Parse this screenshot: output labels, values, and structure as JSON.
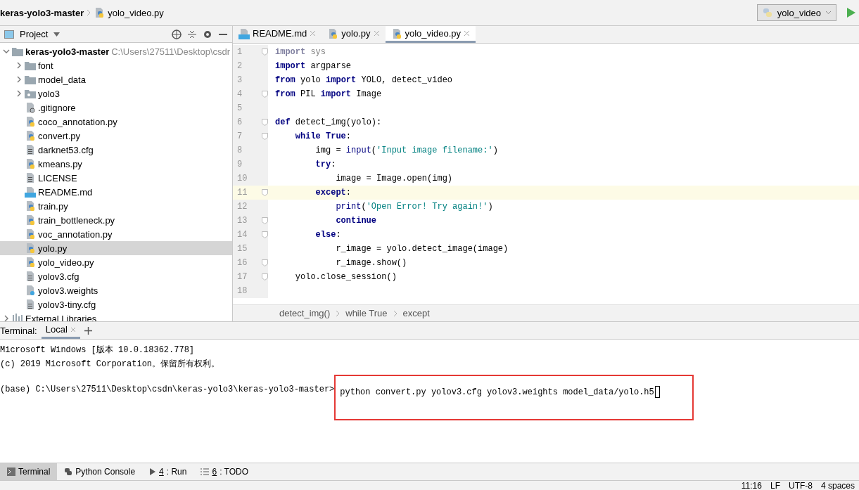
{
  "navbar": {
    "crumbs": [
      {
        "label": "keras-yolo3-master",
        "kind": "folder"
      },
      {
        "label": "yolo_video.py",
        "kind": "python"
      }
    ],
    "run_config": "yolo_video"
  },
  "project": {
    "title": "Project",
    "tree": [
      {
        "label": "keras-yolo3-master",
        "kind": "folder",
        "path": "C:\\Users\\27511\\Desktop\\csdr",
        "expanded": true,
        "selected": false,
        "children": [
          {
            "label": "font",
            "kind": "folder",
            "expanded": false,
            "selected": false
          },
          {
            "label": "model_data",
            "kind": "folder",
            "expanded": false,
            "selected": false
          },
          {
            "label": "yolo3",
            "kind": "package",
            "expanded": false,
            "selected": false
          },
          {
            "label": ".gitignore",
            "kind": "ignore",
            "selected": false
          },
          {
            "label": "coco_annotation.py",
            "kind": "python",
            "selected": false
          },
          {
            "label": "convert.py",
            "kind": "python",
            "selected": false
          },
          {
            "label": "darknet53.cfg",
            "kind": "text",
            "selected": false
          },
          {
            "label": "kmeans.py",
            "kind": "python",
            "selected": false
          },
          {
            "label": "LICENSE",
            "kind": "text",
            "selected": false
          },
          {
            "label": "README.md",
            "kind": "md",
            "selected": false
          },
          {
            "label": "train.py",
            "kind": "python",
            "selected": false
          },
          {
            "label": "train_bottleneck.py",
            "kind": "python",
            "selected": false
          },
          {
            "label": "voc_annotation.py",
            "kind": "python",
            "selected": false
          },
          {
            "label": "yolo.py",
            "kind": "python",
            "selected": true
          },
          {
            "label": "yolo_video.py",
            "kind": "python",
            "selected": false
          },
          {
            "label": "yolov3.cfg",
            "kind": "text",
            "selected": false
          },
          {
            "label": "yolov3.weights",
            "kind": "unknown",
            "selected": false
          },
          {
            "label": "yolov3-tiny.cfg",
            "kind": "text",
            "selected": false
          }
        ]
      },
      {
        "label": "External Libraries",
        "kind": "library",
        "expanded": false,
        "selected": false
      }
    ]
  },
  "editor": {
    "tabs": [
      {
        "label": "README.md",
        "kind": "md",
        "selected": false
      },
      {
        "label": "yolo.py",
        "kind": "python",
        "selected": false
      },
      {
        "label": "yolo_video.py",
        "kind": "python",
        "selected": true
      }
    ],
    "lines": [
      {
        "number": "1",
        "fold": true,
        "current": false,
        "tokens": [
          {
            "text": "import",
            "kind": "dimkw"
          },
          {
            "text": " sys",
            "kind": "dim"
          }
        ]
      },
      {
        "number": "2",
        "fold": false,
        "current": false,
        "tokens": [
          {
            "text": "import",
            "kind": "keyword"
          },
          {
            "text": " argparse",
            "kind": "plain"
          }
        ]
      },
      {
        "number": "3",
        "fold": false,
        "current": false,
        "tokens": [
          {
            "text": "from",
            "kind": "keyword"
          },
          {
            "text": " yolo ",
            "kind": "plain"
          },
          {
            "text": "import",
            "kind": "keyword"
          },
          {
            "text": " YOLO, detect_video",
            "kind": "plain"
          }
        ]
      },
      {
        "number": "4",
        "fold": true,
        "current": false,
        "tokens": [
          {
            "text": "from",
            "kind": "keyword"
          },
          {
            "text": " PIL ",
            "kind": "plain"
          },
          {
            "text": "import",
            "kind": "keyword"
          },
          {
            "text": " Image",
            "kind": "plain"
          }
        ]
      },
      {
        "number": "5",
        "fold": false,
        "current": false
      },
      {
        "number": "6",
        "fold": true,
        "current": false,
        "tokens": [
          {
            "text": "def",
            "kind": "keyword"
          },
          {
            "text": " detect_img(yolo):",
            "kind": "plain"
          }
        ]
      },
      {
        "number": "7",
        "fold": true,
        "current": false,
        "tokens": [
          {
            "text": "    while True",
            "kind": "keyword"
          },
          {
            "text": ":",
            "kind": "plain"
          }
        ]
      },
      {
        "number": "8",
        "fold": false,
        "current": false,
        "tokens": [
          {
            "text": "        img = ",
            "kind": "plain"
          },
          {
            "text": "input",
            "kind": "builtin"
          },
          {
            "text": "(",
            "kind": "plain"
          },
          {
            "text": "'Input image filename:'",
            "kind": "string"
          },
          {
            "text": ")",
            "kind": "plain"
          }
        ]
      },
      {
        "number": "9",
        "fold": false,
        "current": false,
        "tokens": [
          {
            "text": "        try",
            "kind": "keyword"
          },
          {
            "text": ":",
            "kind": "plain"
          }
        ]
      },
      {
        "number": "10",
        "fold": false,
        "current": false,
        "tokens": [
          {
            "text": "            image = Image.open(img)",
            "kind": "plain"
          }
        ]
      },
      {
        "number": "11",
        "fold": true,
        "current": true,
        "tokens": [
          {
            "text": "        except",
            "kind": "keyword"
          },
          {
            "text": ":",
            "kind": "plain"
          }
        ]
      },
      {
        "number": "12",
        "fold": false,
        "current": false,
        "tokens": [
          {
            "text": "            print",
            "kind": "builtin"
          },
          {
            "text": "(",
            "kind": "plain"
          },
          {
            "text": "'Open Error! Try again!'",
            "kind": "string"
          },
          {
            "text": ")",
            "kind": "plain"
          }
        ]
      },
      {
        "number": "13",
        "fold": true,
        "current": false,
        "tokens": [
          {
            "text": "            continue",
            "kind": "keyword"
          }
        ]
      },
      {
        "number": "14",
        "fold": true,
        "current": false,
        "tokens": [
          {
            "text": "        else",
            "kind": "keyword"
          },
          {
            "text": ":",
            "kind": "plain"
          }
        ]
      },
      {
        "number": "15",
        "fold": false,
        "current": false,
        "tokens": [
          {
            "text": "            r_image = yolo.detect_image(image)",
            "kind": "plain"
          }
        ]
      },
      {
        "number": "16",
        "fold": true,
        "current": false,
        "tokens": [
          {
            "text": "            r_image.show()",
            "kind": "plain"
          }
        ]
      },
      {
        "number": "17",
        "fold": true,
        "current": false,
        "tokens": [
          {
            "text": "    yolo.close_session()",
            "kind": "plain"
          }
        ]
      },
      {
        "number": "18",
        "fold": false,
        "current": false
      }
    ],
    "breadcrumbs": [
      "detect_img()",
      "while True",
      "except"
    ]
  },
  "terminal": {
    "label": "Terminal:",
    "tabs": [
      {
        "label": "Local",
        "selected": true
      }
    ],
    "lines": [
      "Microsoft Windows [版本 10.0.18362.778]",
      "(c) 2019 Microsoft Corporation。保留所有权利。"
    ],
    "prompt": "(base) C:\\Users\\27511\\Desktop\\csdn\\keras-yolo3\\keras-yolo3-master>",
    "command": "python convert.py yolov3.cfg yolov3.weights model_data/yolo.h5",
    "highlighted": true
  },
  "tool_windows": [
    {
      "label": "Terminal",
      "kind": "terminal",
      "selected": true
    },
    {
      "label": "Python Console",
      "kind": "python",
      "selected": false
    },
    {
      "key": "4",
      "label": ": Run",
      "kind": "run",
      "selected": false
    },
    {
      "key": "6",
      "label": ": TODO",
      "kind": "todo",
      "selected": false
    }
  ],
  "status_bar": [
    "11:16",
    "LF",
    "UTF-8",
    "4 spaces"
  ]
}
